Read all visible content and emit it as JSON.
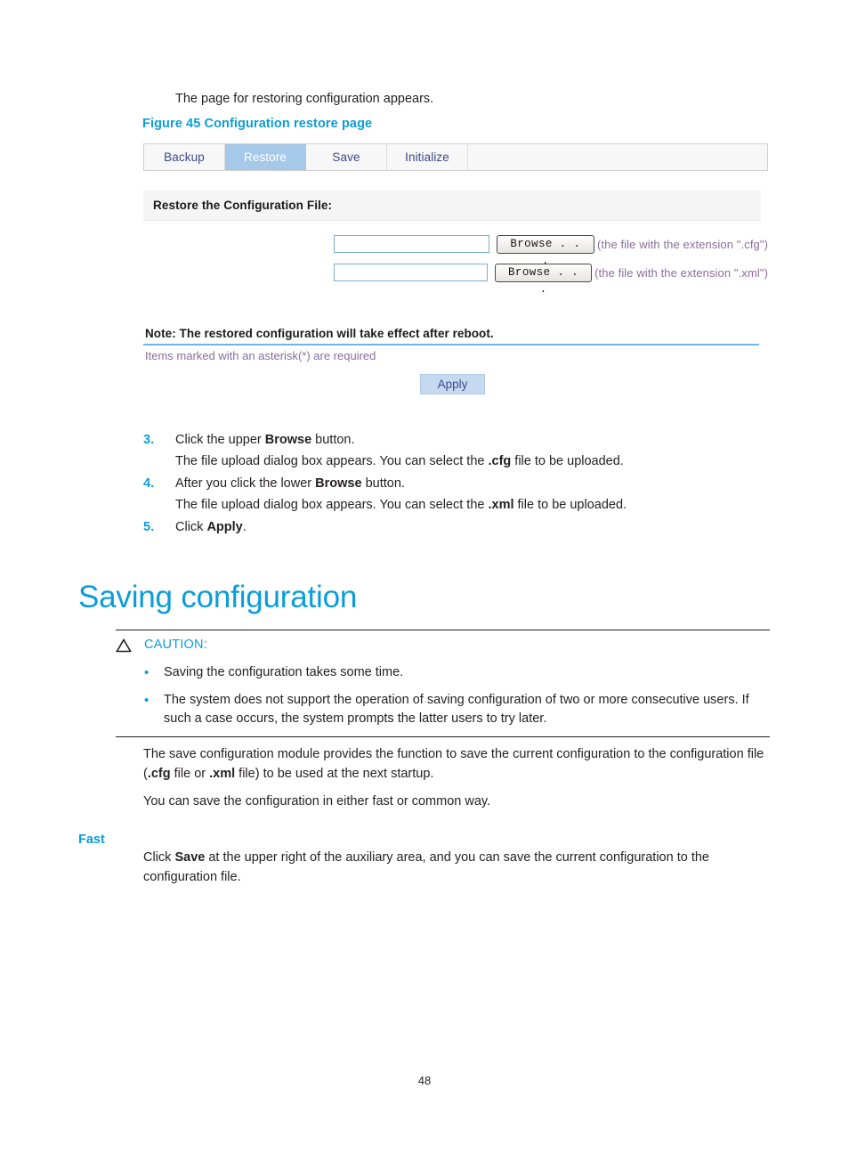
{
  "document": {
    "page_number": "48",
    "intro_text": "The page for restoring configuration appears.",
    "figure_caption": "Figure 45 Configuration restore page"
  },
  "figure": {
    "tabs": [
      {
        "label": "Backup",
        "active": false
      },
      {
        "label": "Restore",
        "active": true
      },
      {
        "label": "Save",
        "active": false
      },
      {
        "label": "Initialize",
        "active": false
      }
    ],
    "panel_header": "Restore the Configuration File:",
    "rows": [
      {
        "input_value": "",
        "input_placeholder": "",
        "button_label": "Browse . . .",
        "hint": "(the file with the extension \".cfg\")"
      },
      {
        "input_value": "",
        "input_placeholder": "",
        "button_label": "Browse . . .",
        "hint": "(the file with the extension \".xml\")"
      }
    ],
    "note": "Note: The restored configuration will take effect after reboot.",
    "required_note": "Items marked with an asterisk(*) are required",
    "apply_label": "Apply",
    "colors": {
      "active_tab_bg": "#a6c9ea",
      "tab_text": "#3c4a8c",
      "hint_text": "#8a6d9a",
      "apply_bg": "#c5d9f1",
      "rule": "#6fb5e8"
    }
  },
  "steps": [
    {
      "number": "3.",
      "text_before": "Click the upper ",
      "text_bold": "Browse",
      "text_after": " button.",
      "sub": {
        "before": "The file upload dialog box appears. You can select the ",
        "bold": ".cfg",
        "after": " file to be uploaded."
      }
    },
    {
      "number": "4.",
      "text_before": "After you click the lower ",
      "text_bold": "Browse",
      "text_after": " button.",
      "sub": {
        "before": "The file upload dialog box appears. You can select the ",
        "bold": ".xml",
        "after": " file to be uploaded."
      }
    },
    {
      "number": "5.",
      "text_before": "Click ",
      "text_bold": "Apply",
      "text_after": ".",
      "sub": null
    }
  ],
  "section": {
    "heading": "Saving configuration",
    "caution": {
      "icon": "caution-triangle-icon",
      "title": "CAUTION:",
      "items": [
        "Saving the configuration takes some time.",
        "The system does not support the operation of saving configuration of two or more consecutive users. If such a case occurs, the system prompts the latter users to try later."
      ]
    },
    "paragraph_1": {
      "a": "The save configuration module provides the function to save the current configuration to the configuration file (",
      "b1": ".cfg",
      "c": " file or ",
      "b2": ".xml",
      "d": " file) to be used at the next startup."
    },
    "paragraph_2": "You can save the configuration in either fast or common way.",
    "sub_heading": "Fast",
    "paragraph_3": {
      "a": "Click ",
      "b": "Save",
      "c": " at the upper right of the auxiliary area, and you can save the current configuration to the configuration file."
    }
  },
  "theme": {
    "accent": "#0b9dd9",
    "text": "#231f20"
  }
}
